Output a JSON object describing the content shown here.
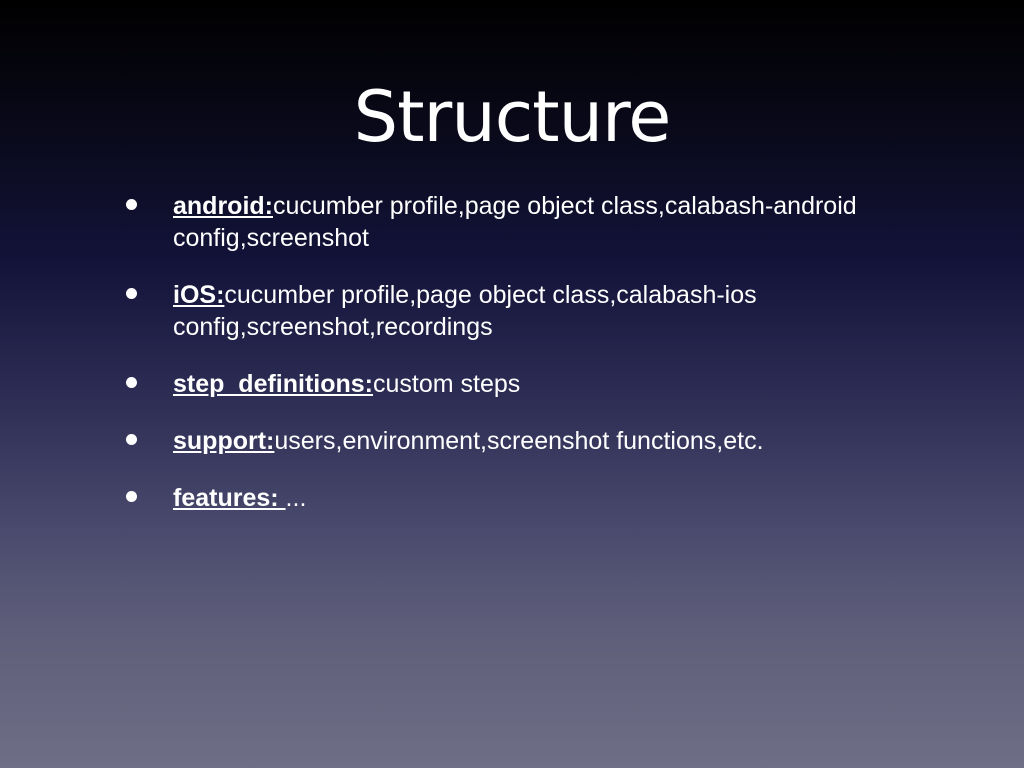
{
  "slide": {
    "title": "Structure",
    "bullets": [
      {
        "term": "android:",
        "text": "cucumber profile,page object class,calabash-android config,screenshot"
      },
      {
        "term": "iOS:",
        "text": "cucumber profile,page object class,calabash-ios config,screenshot,recordings"
      },
      {
        "term": "step_definitions:",
        "text": "custom steps"
      },
      {
        "term": "support:",
        "text": "users,environment,screenshot functions,etc."
      },
      {
        "term": "features: ",
        "text": "..."
      }
    ]
  }
}
